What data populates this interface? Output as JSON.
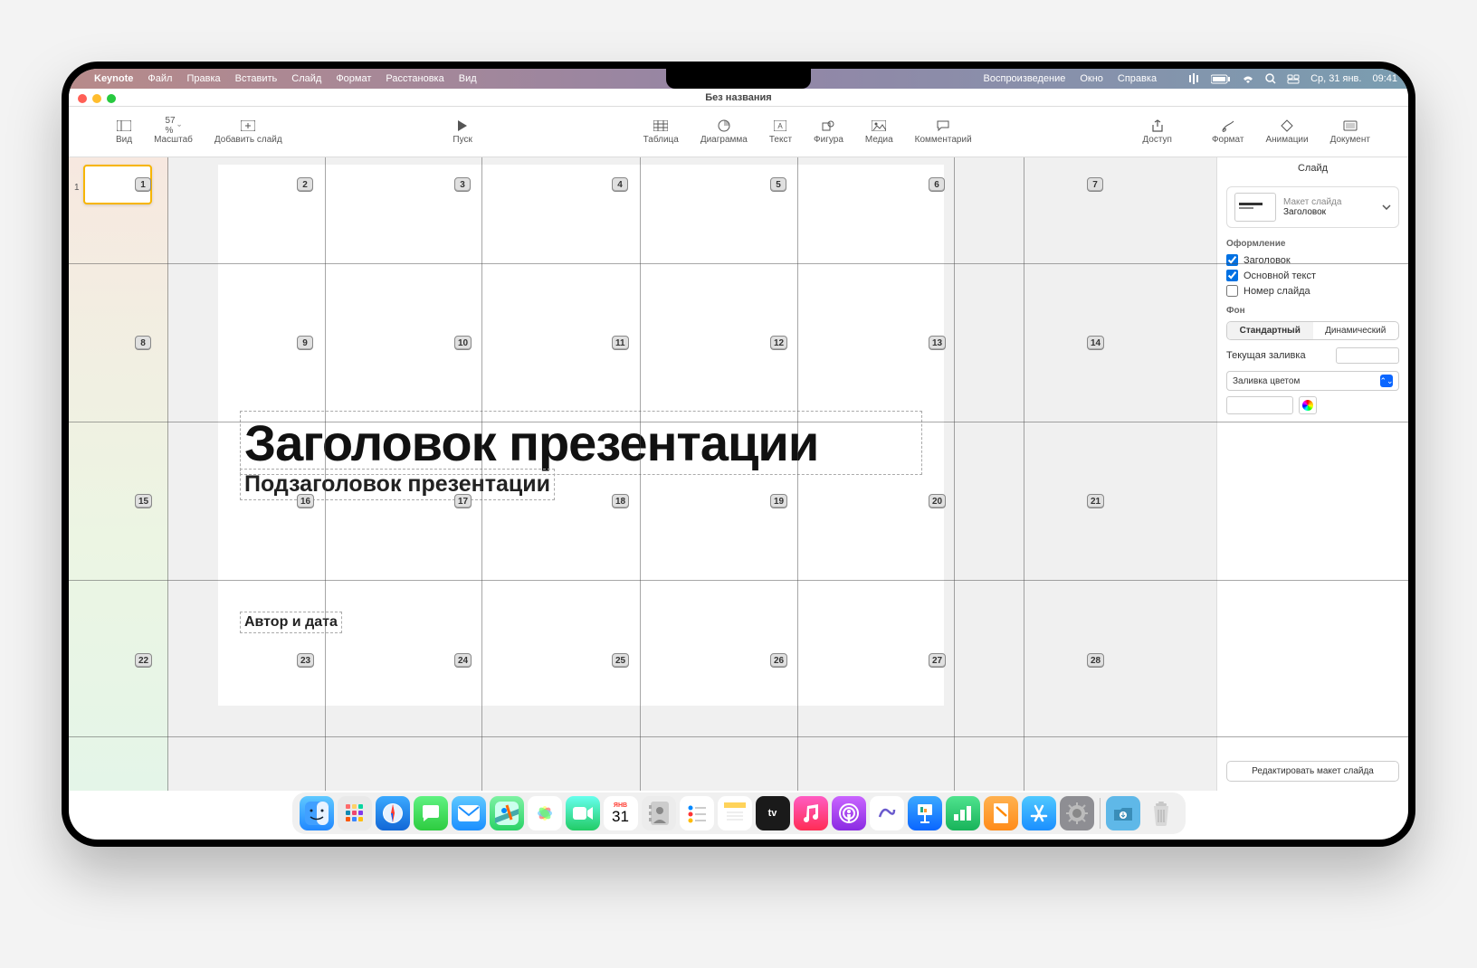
{
  "menubar": {
    "app": "Keynote",
    "items": [
      "Файл",
      "Правка",
      "Вставить",
      "Слайд",
      "Формат",
      "Расстановка",
      "Вид"
    ],
    "right_items": [
      "Воспроизведение",
      "Окно",
      "Справка"
    ],
    "date": "Ср, 31 янв.",
    "time": "09:41"
  },
  "window": {
    "title": "Без названия"
  },
  "toolbar": {
    "view": "Вид",
    "zoom_label": "Масштаб",
    "zoom_value": "57 %",
    "add_slide": "Добавить слайд",
    "play": "Пуск",
    "table": "Таблица",
    "chart": "Диаграмма",
    "text": "Текст",
    "shape": "Фигура",
    "media": "Медиа",
    "comment": "Комментарий",
    "share": "Доступ"
  },
  "inspector": {
    "tabs": {
      "format": "Формат",
      "animate": "Анимации",
      "document": "Документ"
    },
    "subtab": "Слайд",
    "layout_label": "Макет слайда",
    "layout_name": "Заголовок",
    "appearance_head": "Оформление",
    "chk_title": "Заголовок",
    "chk_body": "Основной текст",
    "chk_number": "Номер слайда",
    "bg_head": "Фон",
    "seg_standard": "Стандартный",
    "seg_dynamic": "Динамический",
    "current_fill": "Текущая заливка",
    "fill_type": "Заливка цветом",
    "edit_layout": "Редактировать макет слайда"
  },
  "slide": {
    "title": "Заголовок презентации",
    "subtitle": "Подзаголовок презентации",
    "author": "Автор и дата",
    "thumb_index": "1"
  },
  "tags": [
    "1",
    "2",
    "3",
    "4",
    "5",
    "6",
    "7",
    "8",
    "9",
    "10",
    "11",
    "12",
    "13",
    "14",
    "15",
    "16",
    "17",
    "18",
    "19",
    "20",
    "21",
    "22",
    "23",
    "24",
    "25",
    "26",
    "27",
    "28"
  ],
  "dock": {
    "apps": [
      "finder",
      "launchpad",
      "safari",
      "messages",
      "mail",
      "maps",
      "photos",
      "facetime",
      "calendar",
      "contacts",
      "reminders",
      "notes",
      "tv",
      "music",
      "podcasts",
      "freeform",
      "appstore",
      "keynote",
      "numbers",
      "pages",
      "store2",
      "settings"
    ],
    "calendar_month": "ЯНВ",
    "calendar_day": "31"
  }
}
